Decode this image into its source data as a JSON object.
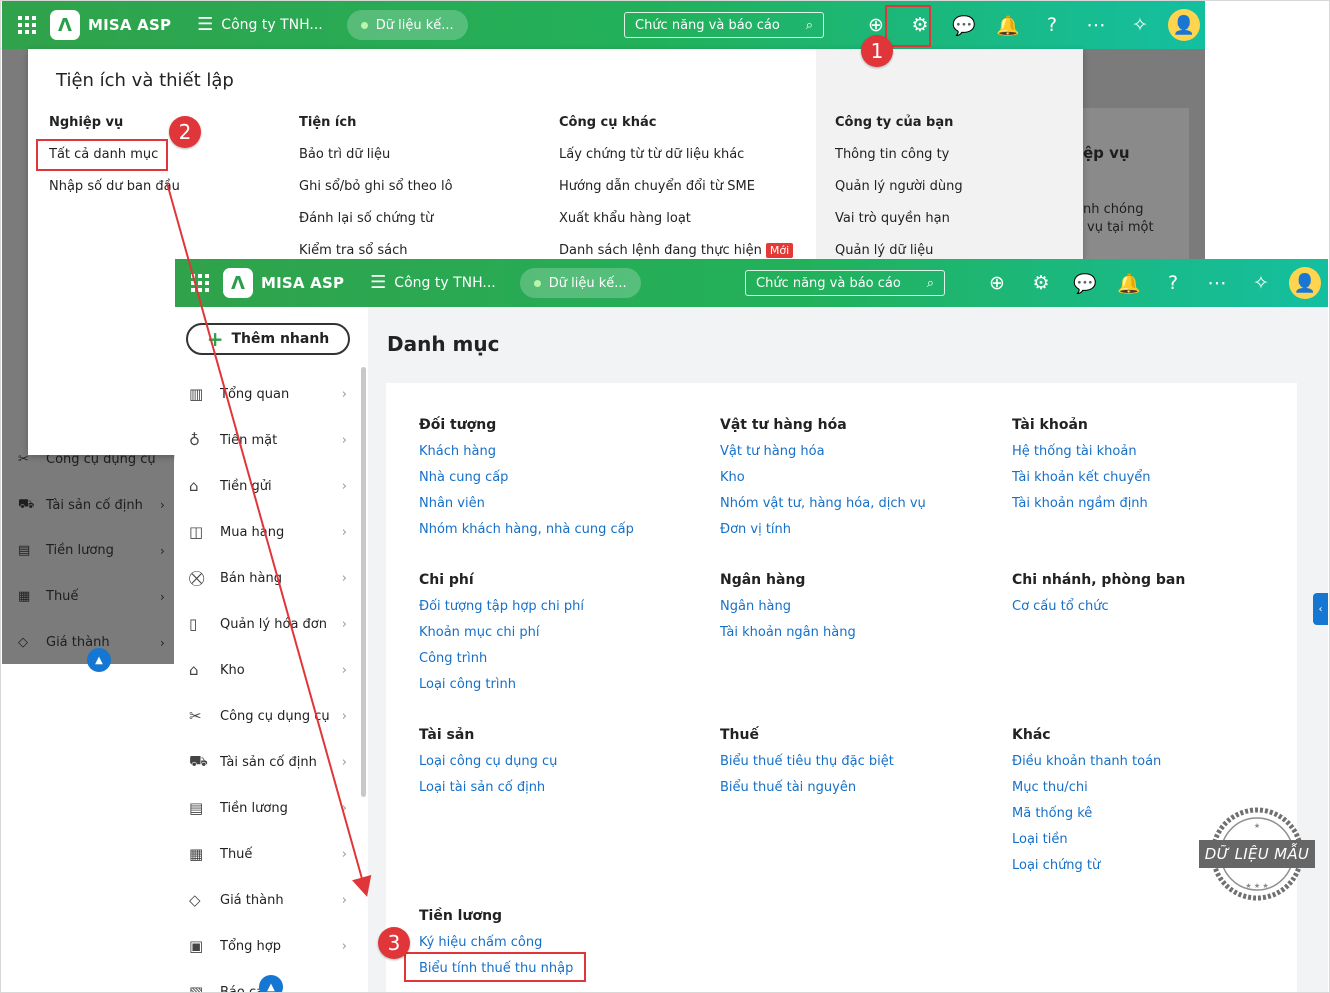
{
  "app": {
    "logo_letter": "Λ",
    "logo_name": "MISA ASP",
    "company_name": "Công ty TNH...",
    "data_label": "Dữ liệu kế...",
    "search_placeholder": "Chức năng và báo cáo",
    "user_glyph": "👤"
  },
  "background_sidebar": [
    "Công cụ dụng cụ",
    "Tài sản cố định",
    "Tiền lương",
    "Thuế",
    "Giá thành"
  ],
  "background_card": {
    "heading": "ệp vụ",
    "line1": "nh chóng",
    "line2": "vụ tại một"
  },
  "popup": {
    "title": "Tiện ích và thiết lập",
    "columns": [
      {
        "heading": "Nghiệp vụ",
        "items": [
          "Tất cả danh mục",
          "Nhập số dư ban đầu"
        ]
      },
      {
        "heading": "Tiện ích",
        "items": [
          "Bảo trì dữ liệu",
          "Ghi sổ/bỏ ghi sổ theo lô",
          "Đánh lại số chứng từ",
          "Kiểm tra sổ sách"
        ]
      },
      {
        "heading": "Công cụ khác",
        "items": [
          "Lấy chứng từ từ dữ liệu khác",
          "Hướng dẫn chuyển đổi từ SME",
          "Xuất khẩu hàng loạt",
          "Danh sách lệnh đang thực hiện"
        ]
      },
      {
        "heading": "Công ty của bạn",
        "items": [
          "Thông tin công ty",
          "Quản lý người dùng",
          "Vai trò quyền hạn",
          "Quản lý dữ liệu"
        ]
      }
    ],
    "new_badge": "Mới"
  },
  "sidebar": {
    "add_button": "Thêm nhanh",
    "items": [
      {
        "label": "Tổng quan",
        "icon": "dashboard-icon"
      },
      {
        "label": "Tiền mặt",
        "icon": "money-bag-icon"
      },
      {
        "label": "Tiền gửi",
        "icon": "bank-icon"
      },
      {
        "label": "Mua hàng",
        "icon": "shopping-bag-icon"
      },
      {
        "label": "Bán hàng",
        "icon": "cart-icon"
      },
      {
        "label": "Quản lý hóa đơn",
        "icon": "invoice-icon"
      },
      {
        "label": "Kho",
        "icon": "warehouse-icon"
      },
      {
        "label": "Công cụ dụng cụ",
        "icon": "tools-icon"
      },
      {
        "label": "Tài sản cố định",
        "icon": "car-icon"
      },
      {
        "label": "Tiền lương",
        "icon": "salary-icon"
      },
      {
        "label": "Thuế",
        "icon": "tax-icon"
      },
      {
        "label": "Giá thành",
        "icon": "price-tag-icon"
      },
      {
        "label": "Tổng hợp",
        "icon": "summary-icon"
      },
      {
        "label": "Báo cáo",
        "icon": "report-icon"
      }
    ]
  },
  "main": {
    "title": "Danh mục",
    "groups": [
      {
        "heading": "Đối tượng",
        "links": [
          "Khách hàng",
          "Nhà cung cấp",
          "Nhân viên",
          "Nhóm khách hàng, nhà cung cấp"
        ]
      },
      {
        "heading": "Vật tư hàng hóa",
        "links": [
          "Vật tư hàng hóa",
          "Kho",
          "Nhóm vật tư, hàng hóa, dịch vụ",
          "Đơn vị tính"
        ]
      },
      {
        "heading": "Tài khoản",
        "links": [
          "Hệ thống tài khoản",
          "Tài khoản kết chuyển",
          "Tài khoản ngầm định"
        ]
      },
      {
        "heading": "Chi phí",
        "links": [
          "Đối tượng tập hợp chi phí",
          "Khoản mục chi phí",
          "Công trình",
          "Loại công trình"
        ]
      },
      {
        "heading": "Ngân hàng",
        "links": [
          "Ngân hàng",
          "Tài khoản ngân hàng"
        ]
      },
      {
        "heading": "Chi nhánh, phòng ban",
        "links": [
          "Cơ cấu tổ chức"
        ]
      },
      {
        "heading": "Tài sản",
        "links": [
          "Loại công cụ dụng cụ",
          "Loại tài sản cố định"
        ]
      },
      {
        "heading": "Thuế",
        "links": [
          "Biểu thuế tiêu thụ đặc biệt",
          "Biểu thuế tài nguyên"
        ]
      },
      {
        "heading": "Khác",
        "links": [
          "Điều khoản thanh toán",
          "Mục thu/chi",
          "Mã thống kê",
          "Loại tiền",
          "Loại chứng từ"
        ]
      },
      {
        "heading": "Tiền lương",
        "links": [
          "Ký hiệu chấm công",
          "Biểu tính thuế thu nhập"
        ]
      }
    ]
  },
  "watermark": "DỮ LIỆU MẪU",
  "steps": [
    "1",
    "2",
    "3"
  ],
  "colors": {
    "accent_green": "#2aa24a",
    "link_blue": "#1570c9",
    "highlight_red": "#e0363a"
  }
}
